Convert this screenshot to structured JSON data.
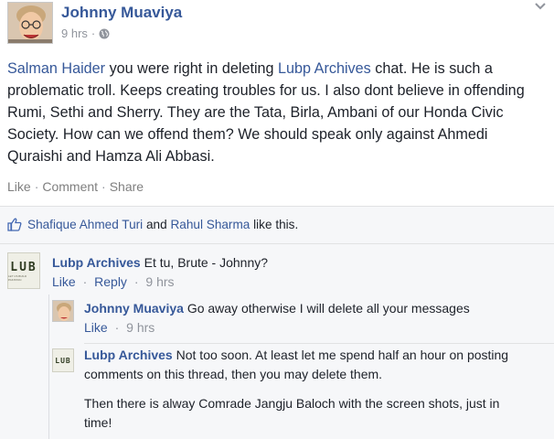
{
  "post": {
    "author": "Johnny Muaviya",
    "time": "9 hrs",
    "dot": "·",
    "text_parts": [
      {
        "type": "mention",
        "text": "Salman Haider"
      },
      {
        "type": "text",
        "text": " you were right in deleting "
      },
      {
        "type": "mention",
        "text": "Lubp Archives"
      },
      {
        "type": "text",
        "text": " chat. He is such a problematic troll. Keeps creating troubles for us. I also dont believe in offending Rumi, Sethi and Sherry. They are the Tata, Birla, Ambani of our Honda Civic Society. How can we offend them? We should speak only against Ahmedi Quraishi and Hamza Ali Abbasi."
      }
    ],
    "actions": {
      "like": "Like",
      "comment": "Comment",
      "share": "Share",
      "sep": "·"
    }
  },
  "likes": {
    "person1": "Shafique Ahmed Turi",
    "and": "and",
    "person2": "Rahul Sharma",
    "suffix": "like this."
  },
  "comments": [
    {
      "author": "Lubp Archives",
      "text": "Et tu, Brute - Johnny?",
      "like": "Like",
      "reply": "Reply",
      "time": "9 hrs",
      "logo_text": "LUB",
      "logo_sub": "LET US BUILD PAKISTAN"
    }
  ],
  "replies": [
    {
      "author": "Johnny Muaviya",
      "text": "Go away otherwise I will delete all your messages",
      "like": "Like",
      "time": "9 hrs"
    },
    {
      "author": "Lubp Archives",
      "text": "Not too soon. At least let me spend half an hour on posting comments on this thread, then you may delete them.",
      "text2": "Then there is alway Comrade Jangju Baloch with the screen shots, just in time!",
      "logo_text": "LUB",
      "logo_sub": "LET US BUILD PAKISTAN"
    }
  ],
  "colors": {
    "link": "#365899",
    "muted": "#90949c",
    "bg_comments": "#f6f7f9"
  }
}
